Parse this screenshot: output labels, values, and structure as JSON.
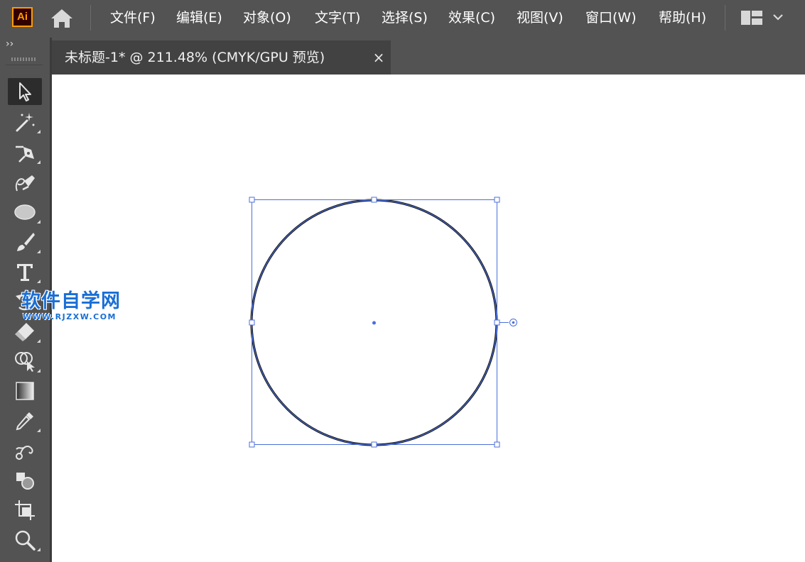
{
  "app": {
    "logo_text": "Ai",
    "accent": "#ff9a00"
  },
  "menu": {
    "items": [
      {
        "label": "文件(F)"
      },
      {
        "label": "编辑(E)"
      },
      {
        "label": "对象(O)"
      },
      {
        "label": "文字(T)"
      },
      {
        "label": "选择(S)"
      },
      {
        "label": "效果(C)"
      },
      {
        "label": "视图(V)"
      },
      {
        "label": "窗口(W)"
      },
      {
        "label": "帮助(H)"
      }
    ]
  },
  "toolbar": {
    "collapse_label": "››",
    "tools": [
      {
        "name": "selection-tool",
        "icon": "arrow-icon",
        "active": true
      },
      {
        "name": "magic-wand-tool",
        "icon": "magic-wand-icon"
      },
      {
        "name": "pen-tool",
        "icon": "pen-icon"
      },
      {
        "name": "curvature-tool",
        "icon": "curvature-pen-icon"
      },
      {
        "name": "ellipse-tool",
        "icon": "ellipse-icon"
      },
      {
        "name": "paintbrush-tool",
        "icon": "brush-icon"
      },
      {
        "name": "type-tool",
        "icon": "type-icon"
      },
      {
        "name": "rotate-tool",
        "icon": "rotate-icon"
      },
      {
        "name": "eraser-tool",
        "icon": "eraser-icon"
      },
      {
        "name": "shape-builder-tool",
        "icon": "shape-builder-icon"
      },
      {
        "name": "gradient-tool",
        "icon": "gradient-icon"
      },
      {
        "name": "eyedropper-tool",
        "icon": "eyedropper-icon"
      },
      {
        "name": "blend-tool",
        "icon": "blend-icon"
      },
      {
        "name": "fill-stroke-tool",
        "icon": "fill-stroke-icon"
      },
      {
        "name": "artboard-tool",
        "icon": "artboard-icon"
      },
      {
        "name": "zoom-tool",
        "icon": "zoom-icon"
      }
    ]
  },
  "document": {
    "tab_title": "未标题-1*  @  211.48% (CMYK/GPU 预览)",
    "close_label": "×"
  },
  "selection": {
    "bounding_color": "#4b6fd8",
    "stroke_color": "#111111"
  },
  "watermark": {
    "main": "软件自学网",
    "sub": "WWW.RJZXW.COM"
  }
}
